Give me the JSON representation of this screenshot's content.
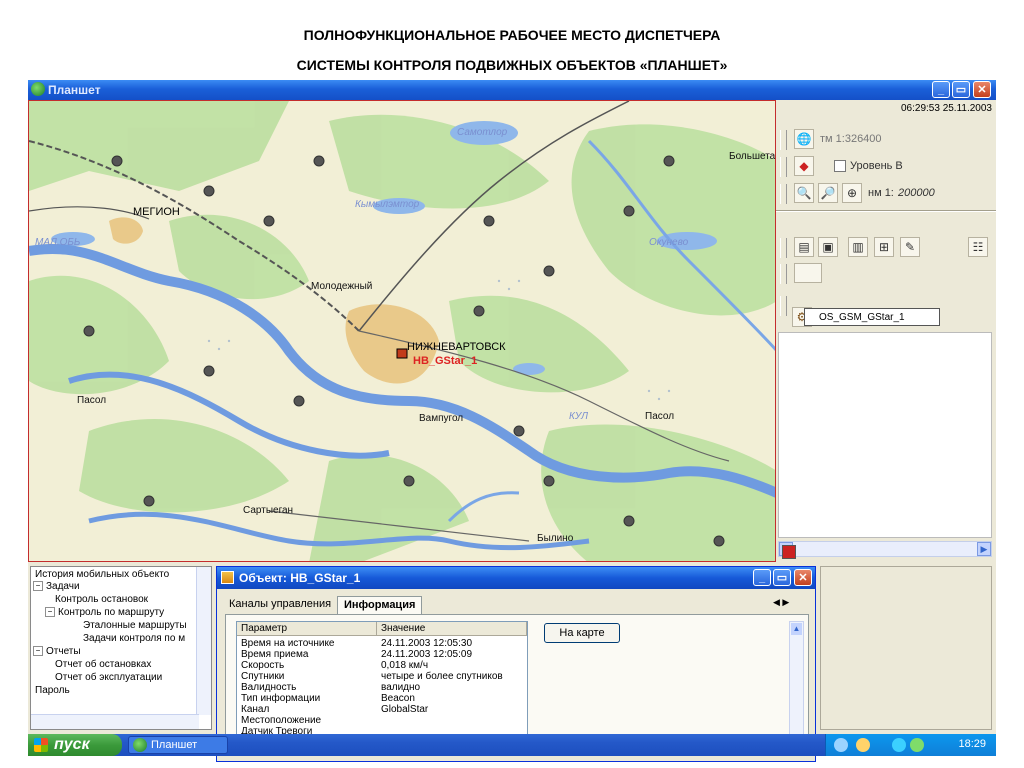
{
  "slide": {
    "title_line1": "ПОЛНОФУНКЦИОНАЛЬНОЕ РАБОЧЕЕ МЕСТО ДИСПЕТЧЕРА",
    "title_line2": "СИСТЕМЫ КОНТРОЛЯ ПОДВИЖНЫХ ОБЪЕКТОВ «ПЛАНШЕТ»"
  },
  "window": {
    "title": "Планшет",
    "minimize": "_",
    "maximize": "▭",
    "close": "✕"
  },
  "map": {
    "cities": [
      "МЕГИОН",
      "НИЖНЕВАРТОВСК",
      "Молодежный",
      "Пасол",
      "Вампугол",
      "Пасол",
      "Сартыеган",
      "Былино",
      "Большетарх"
    ],
    "water_labels": [
      "Самотлор",
      "Кымылэмтор",
      "МАЛ.ОБЬ",
      "Окунево",
      "КУЛ"
    ],
    "object_label": "НВ_GStar_1"
  },
  "right_panel": {
    "datetime": "06:29:53 25.11.2003",
    "scale_tm": "тм 1:326400",
    "level_label": "Уровень В",
    "scale_nm_prefix": "нм 1:",
    "scale_nm_value": "200000",
    "object_item": "OS_GSM_GStar_1"
  },
  "tree": {
    "items": [
      {
        "label": "История мобильных объекто",
        "indent": 0,
        "pm": ""
      },
      {
        "label": "Задачи",
        "indent": 0,
        "pm": "−"
      },
      {
        "label": "Контроль остановок",
        "indent": 1,
        "pm": ""
      },
      {
        "label": "Контроль по маршруту",
        "indent": 1,
        "pm": "−"
      },
      {
        "label": "Эталонные маршруты",
        "indent": 2,
        "pm": ""
      },
      {
        "label": "Задачи контроля по м",
        "indent": 2,
        "pm": ""
      },
      {
        "label": "Отчеты",
        "indent": 0,
        "pm": "−"
      },
      {
        "label": "Отчет об остановках",
        "indent": 1,
        "pm": ""
      },
      {
        "label": "Отчет об эксплуатации",
        "indent": 1,
        "pm": ""
      },
      {
        "label": "Пароль",
        "indent": 0,
        "pm": ""
      }
    ]
  },
  "dialog": {
    "title": "Объект: НВ_GStar_1",
    "tabs": [
      "Каналы управления",
      "Информация"
    ],
    "active_tab": "Информация",
    "headers": [
      "Параметр",
      "Значение"
    ],
    "rows": [
      [
        "Время на источнике",
        "24.11.2003 12:05:30"
      ],
      [
        "Время приема",
        "24.11.2003 12:05:09"
      ],
      [
        "Скорость",
        "0,018 км/ч"
      ],
      [
        "Спутники",
        "четыре и более спутников"
      ],
      [
        "Валидность",
        "валидно"
      ],
      [
        "Тип информации",
        "Beacon"
      ],
      [
        "Канал",
        "GlobalStar"
      ],
      [
        "Местоположение",
        ""
      ],
      [
        "Датчик Тревоги",
        ""
      ]
    ],
    "on_map_button": "На карте"
  },
  "taskbar": {
    "start": "пуск",
    "task": "Планшет",
    "clock": "18:29"
  },
  "colors": {
    "xp_blue": "#1a5fd8",
    "map_border": "#c42d2d",
    "object_red": "#d22222",
    "start_green": "#3b9a3b"
  }
}
